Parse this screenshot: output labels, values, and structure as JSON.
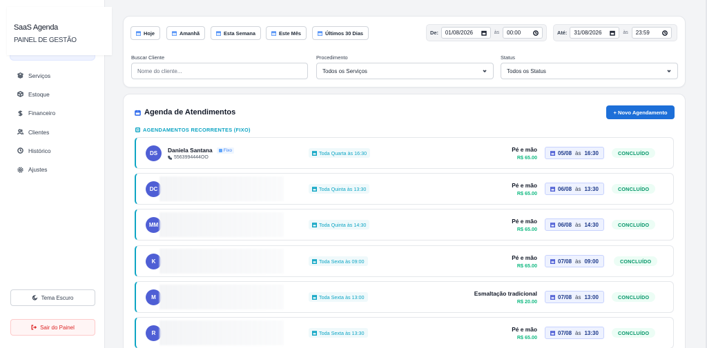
{
  "brand": {
    "name": "SaaS Agenda",
    "subtitle": "PAINEL DE GESTÃO"
  },
  "sidebar": {
    "items": [
      {
        "label": "Serviços",
        "icon": "layers-icon"
      },
      {
        "label": "Estoque",
        "icon": "box-icon"
      },
      {
        "label": "Financeiro",
        "icon": "dollar-icon"
      },
      {
        "label": "Clientes",
        "icon": "users-icon"
      },
      {
        "label": "Histórico",
        "icon": "clock-icon"
      },
      {
        "label": "Ajustes",
        "icon": "gear-icon"
      }
    ],
    "theme_label": "Tema Escuro",
    "logout_label": "Sair do Painel"
  },
  "filters": {
    "quick": [
      "Hoje",
      "Amanhã",
      "Esta Semana",
      "Este Mês",
      "Últimos 30 Dias"
    ],
    "from": {
      "label": "De:",
      "date": "01/08/2026",
      "as": "às",
      "time": "00:00"
    },
    "to": {
      "label": "Até:",
      "date": "31/08/2026",
      "as": "às",
      "time": "23:59"
    },
    "client": {
      "label": "Buscar Cliente",
      "placeholder": "Nome do cliente..."
    },
    "procedure": {
      "label": "Procedimento",
      "value": "Todos os Serviços"
    },
    "status": {
      "label": "Status",
      "value": "Todos os Status"
    }
  },
  "agenda": {
    "title": "Agenda de Atendimentos",
    "new_button": "+ Novo Agendamento",
    "section": "AGENDAMENTOS RECORRENTES (FIXO)",
    "as": "às",
    "rows": [
      {
        "initials": "DS",
        "name": "Daniela Santana",
        "tag": "Fixo",
        "phone": "5563994444OO",
        "recurrence": "Toda Quarta às 16:30",
        "service": "Pé e mão",
        "price": "R$ 65.00",
        "date": "05/08",
        "time": "16:30",
        "status": "CONCLUÍDO"
      },
      {
        "initials": "DC",
        "recurrence": "Toda Quinta às 13:30",
        "service": "Pé e mão",
        "price": "R$ 65.00",
        "date": "06/08",
        "time": "13:30",
        "status": "CONCLUÍDO"
      },
      {
        "initials": "MM",
        "recurrence": "Toda Quinta às 14:30",
        "service": "Pé e mão",
        "price": "R$ 65.00",
        "date": "06/08",
        "time": "14:30",
        "status": "CONCLUÍDO"
      },
      {
        "initials": "K",
        "recurrence": "Toda Sexta às 09:00",
        "service": "Pé e mão",
        "price": "R$ 65.00",
        "date": "07/08",
        "time": "09:00",
        "status": "CONCLUÍDO"
      },
      {
        "initials": "M",
        "recurrence": "Toda Sexta às 13:00",
        "service": "Esmaltação tradicional",
        "price": "R$ 20.00",
        "date": "07/08",
        "time": "13:00",
        "status": "CONCLUÍDO"
      },
      {
        "initials": "R",
        "recurrence": "Toda Sexta às 13:30",
        "service": "Pé e mão",
        "price": "R$ 65.00",
        "date": "07/08",
        "time": "13:30",
        "status": "CONCLUÍDO"
      }
    ]
  }
}
